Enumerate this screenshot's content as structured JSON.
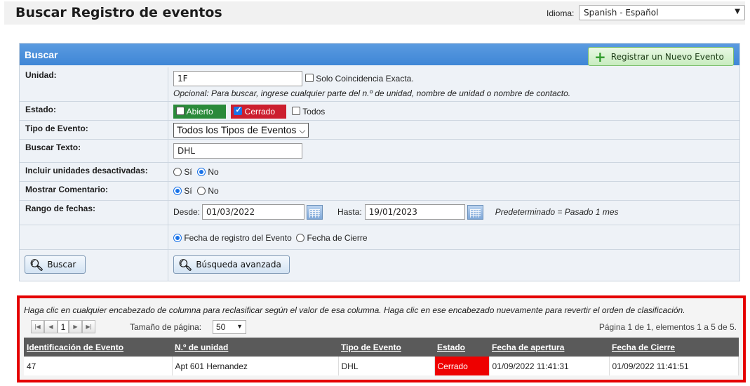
{
  "header": {
    "title": "Buscar Registro de eventos",
    "language_label": "Idioma:",
    "language_value": "Spanish - Español"
  },
  "search": {
    "panel_title": "Buscar",
    "new_event_button": "Registrar un Nuevo Evento",
    "unit": {
      "label": "Unidad:",
      "value": "1F",
      "exact_match_label": "Solo Coincidencia Exacta.",
      "exact_match_checked": false,
      "hint": "Opcional: Para buscar, ingrese cualquier parte del n.º de unidad, nombre de unidad o nombre de contacto."
    },
    "status": {
      "label": "Estado:",
      "open_label": "Abierto",
      "open_checked": false,
      "closed_label": "Cerrado",
      "closed_checked": true,
      "all_label": "Todos",
      "all_checked": false,
      "open_color": "#2a8a3a",
      "closed_color": "#cc1f2f"
    },
    "event_type": {
      "label": "Tipo de Evento:",
      "value": "Todos los Tipos de Eventos"
    },
    "search_text": {
      "label": "Buscar Texto:",
      "value": "DHL"
    },
    "include_inactive": {
      "label": "Incluir unidades desactivadas:",
      "yes_label": "Sí",
      "no_label": "No",
      "selected": "No"
    },
    "show_comment": {
      "label": "Mostrar Comentario:",
      "yes_label": "Sí",
      "no_label": "No",
      "selected": "Sí"
    },
    "date_range": {
      "label": "Rango de fechas:",
      "from_label": "Desde:",
      "from_value": "01/03/2022",
      "to_label": "Hasta:",
      "to_value": "19/01/2023",
      "default_hint": "Predeterminado = Pasado 1 mes",
      "option_registration": "Fecha de registro del Evento",
      "option_close": "Fecha de Cierre",
      "selected_option": "Fecha de registro del Evento"
    },
    "search_button": "Buscar",
    "advanced_button": "Búsqueda avanzada"
  },
  "results": {
    "hint": "Haga clic en cualquier encabezado de columna para reclasificar según el valor de esa columna. Haga clic en ese encabezado nuevamente para revertir el orden de clasificación.",
    "current_page": "1",
    "page_size_label": "Tamaño de página:",
    "page_size": "50",
    "page_info": "Página 1 de 1, elementos 1 a 5 de 5.",
    "columns": [
      "Identificación de Evento",
      "N.º de unidad",
      "Tipo de Evento",
      "Estado",
      "Fecha de apertura",
      "Fecha de Cierre"
    ],
    "rows": [
      [
        "47",
        "Apt 601 Hernandez",
        "DHL",
        "Cerrado",
        "01/09/2022 11:41:31",
        "01/09/2022 11:41:51"
      ]
    ],
    "closed_status_color": "#ee0000"
  }
}
